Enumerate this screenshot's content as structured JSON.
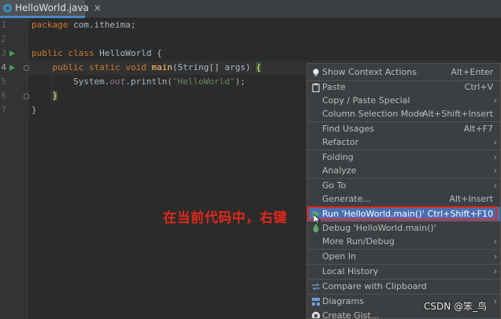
{
  "editor": {
    "tab": {
      "filename": "HelloWorld.java",
      "close": "×"
    },
    "line_numbers": [
      "1",
      "2",
      "3",
      "4",
      "5",
      "6",
      "7"
    ],
    "code": {
      "l1": {
        "kw": "package",
        "rest": " com.itheima;"
      },
      "l3": {
        "kw1": "public",
        "kw2": "class",
        "rest": " HelloWorld {"
      },
      "l4": {
        "kw1": "public",
        "kw2": "static",
        "kw3": "void",
        "fn": "main",
        "params": "(String[] args) ",
        "brace": "{"
      },
      "l5": {
        "obj": "System.",
        "stat": "out",
        "call": ".println(",
        "str": "\"HelloWorld\"",
        "end": ");"
      },
      "l6": {
        "brace": "}"
      },
      "l7": {
        "brace": "}"
      }
    }
  },
  "annotation": "在当前代码中，右键",
  "context_menu": {
    "items": [
      {
        "label": "Show Context Actions",
        "shortcut": "Alt+Enter",
        "icon": "bulb-icon"
      },
      {
        "label": "Paste",
        "shortcut": "Ctrl+V",
        "icon": "clipboard-icon"
      },
      {
        "label": "Copy / Paste Special",
        "submenu": true
      },
      {
        "label": "Column Selection Mode",
        "shortcut": "Alt+Shift+Insert"
      },
      {
        "label": "Find Usages",
        "shortcut": "Alt+F7"
      },
      {
        "label": "Refactor",
        "submenu": true
      },
      {
        "label": "Folding",
        "submenu": true
      },
      {
        "label": "Analyze",
        "submenu": true
      },
      {
        "label": "Go To",
        "submenu": true
      },
      {
        "label": "Generate...",
        "shortcut": "Alt+Insert"
      },
      {
        "label": "Run 'HelloWorld.main()'",
        "shortcut": "Ctrl+Shift+F10",
        "icon": "run-icon",
        "selected": true
      },
      {
        "label": "Debug 'HelloWorld.main()'",
        "icon": "debug-icon"
      },
      {
        "label": "More Run/Debug",
        "submenu": true
      },
      {
        "label": "Open In",
        "submenu": true
      },
      {
        "label": "Local History",
        "submenu": true
      },
      {
        "label": "Compare with Clipboard",
        "icon": "compare-icon"
      },
      {
        "label": "Diagrams",
        "submenu": true,
        "icon": "diagram-icon"
      },
      {
        "label": "Create Gist...",
        "icon": "github-icon"
      }
    ]
  },
  "watermark": "CSDN @笨_鸟",
  "colors": {
    "background": "#2b2b2b",
    "keyword": "#cc7832",
    "string": "#6a8759",
    "function": "#ffc66d",
    "menu_bg": "#3c3f41",
    "menu_selection": "#4b6eaf",
    "annotation_red": "#e0281a",
    "run_green": "#499c54"
  }
}
